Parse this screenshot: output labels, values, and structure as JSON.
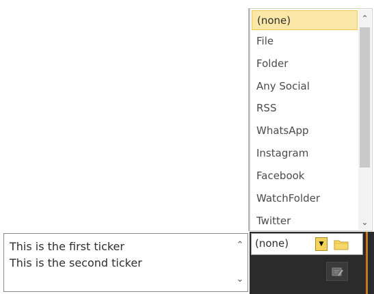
{
  "dropdown": {
    "selected": "(none)",
    "options": [
      "(none)",
      "File",
      "Folder",
      "Any Social",
      "RSS",
      "WhatsApp",
      "Instagram",
      "Facebook",
      "WatchFolder",
      "Twitter"
    ]
  },
  "ticker": {
    "lines": [
      "This is the first ticker",
      "This is the second ticker"
    ]
  },
  "combo": {
    "value": "(none)"
  },
  "icons": {
    "folder": "folder-icon",
    "scroll_up": "chevron-up-icon",
    "scroll_down": "chevron-down-icon",
    "edit_note": "edit-note-icon"
  },
  "colors": {
    "selection_bg": "#fbe7a7",
    "combo_arrow": "#f2d25b",
    "panel_bg": "#2b2b2b",
    "accent_strip": "#c8781a"
  }
}
